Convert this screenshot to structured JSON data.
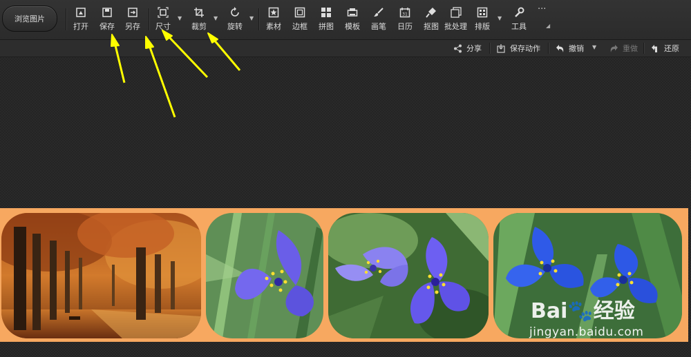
{
  "toolbar": {
    "browse": "浏览图片",
    "tools": [
      {
        "label": "打开",
        "icon": "open-icon"
      },
      {
        "label": "保存",
        "icon": "save-icon"
      },
      {
        "label": "另存",
        "icon": "save-as-icon"
      },
      {
        "label": "尺寸",
        "icon": "resize-icon"
      },
      {
        "label": "裁剪",
        "icon": "crop-icon"
      },
      {
        "label": "旋转",
        "icon": "rotate-icon"
      },
      {
        "label": "素材",
        "icon": "material-icon"
      },
      {
        "label": "边框",
        "icon": "border-icon"
      },
      {
        "label": "拼图",
        "icon": "collage-icon"
      },
      {
        "label": "模板",
        "icon": "template-icon"
      },
      {
        "label": "画笔",
        "icon": "brush-icon"
      },
      {
        "label": "日历",
        "icon": "calendar-icon"
      },
      {
        "label": "抠图",
        "icon": "cutout-icon"
      },
      {
        "label": "批处理",
        "icon": "batch-icon"
      },
      {
        "label": "排版",
        "icon": "layout-icon"
      },
      {
        "label": "工具",
        "icon": "wrench-icon"
      }
    ],
    "more": "···"
  },
  "actionbar": {
    "share": "分享",
    "save_action": "保存动作",
    "undo": "撤销",
    "redo": "重做",
    "restore": "还原"
  },
  "watermark": {
    "logo": "Bai🐾经验",
    "url": "jingyan.baidu.com"
  },
  "colors": {
    "strip": "#f7a860",
    "arrow": "#ffff00"
  }
}
